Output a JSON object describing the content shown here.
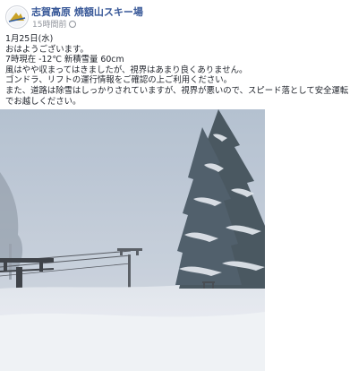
{
  "post": {
    "page_name": "志賀高原 焼額山スキー場",
    "timestamp": "15時間前",
    "lines": [
      "1月25日(水)",
      "おはようございます。",
      "7時現在 -12℃ 新積雪量 60cm",
      "風はやや収まってはきましたが、視界はあまり良くありません。",
      "ゴンドラ、リフトの運行情報をご確認の上ご利用ください。",
      "また、道路は除雪はしっかりされていますが、視界が悪いので、スピード落として安全運転でお越しください。"
    ]
  },
  "icons": {
    "avatar": "ski-resort-logo-icon",
    "privacy": "globe-icon"
  },
  "colors": {
    "page_name": "#385898",
    "timestamp": "#90949c",
    "text": "#1d2129",
    "sky": "#b7c3d3",
    "snow": "#e9edf3",
    "tree": "#3b4a54"
  }
}
